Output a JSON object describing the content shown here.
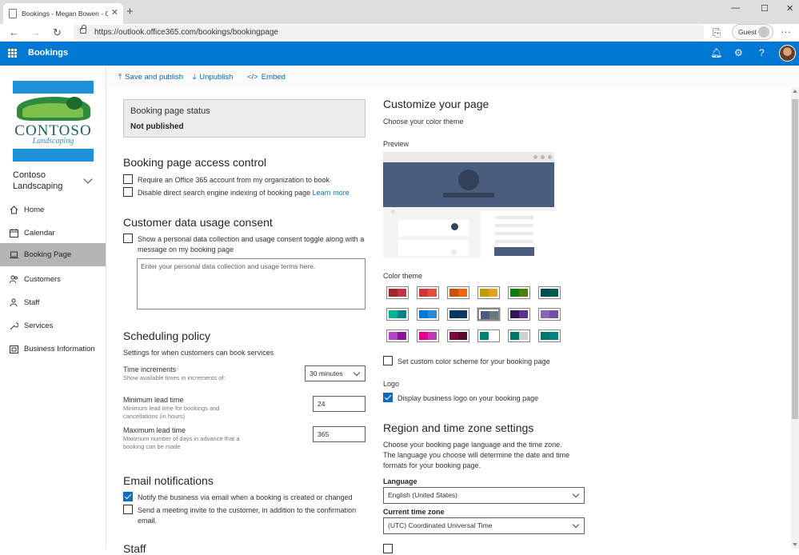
{
  "browser": {
    "tab_title": "Bookings - Megan Bowen - Outlook",
    "url": "https://outlook.office365.com/bookings/bookingpage",
    "guest_label": "Guest"
  },
  "app": {
    "name": "Bookings",
    "accent": "#0078d4"
  },
  "sidebar": {
    "logo_text": "CONTOSO",
    "logo_subtext": "Landscaping",
    "business_name": "Contoso Landscaping",
    "items": [
      {
        "label": "Home",
        "icon": "home-icon"
      },
      {
        "label": "Calendar",
        "icon": "calendar-icon"
      },
      {
        "label": "Booking Page",
        "icon": "laptop-icon",
        "active": true
      },
      {
        "label": "Customers",
        "icon": "customers-icon"
      },
      {
        "label": "Staff",
        "icon": "staff-icon"
      },
      {
        "label": "Services",
        "icon": "wrench-icon"
      },
      {
        "label": "Business Information",
        "icon": "building-icon"
      }
    ]
  },
  "toolbar": {
    "save": "Save and publish",
    "unpublish": "Unpublish",
    "embed": "Embed"
  },
  "status": {
    "label": "Booking page status",
    "value": "Not published"
  },
  "access": {
    "heading": "Booking page access control",
    "opt1": "Require an Office 365 account from my organization to book",
    "opt2": "Disable direct search engine indexing of booking page",
    "learn_more": "Learn more"
  },
  "consent": {
    "heading": "Customer data usage consent",
    "opt": "Show a personal data collection and usage consent toggle along with a message on my booking page",
    "placeholder": "Enter your personal data collection and usage terms here."
  },
  "scheduling": {
    "heading": "Scheduling policy",
    "subtitle": "Settings for when customers can book services",
    "increments_label": "Time increments",
    "increments_help": "Show available times in increments of:",
    "increments_value": "30 minutes",
    "min_label": "Minimum lead time",
    "min_help": "Minimum lead time for bookings and cancellations (in hours)",
    "min_value": "24",
    "max_label": "Maximum lead time",
    "max_help": "Maximum number of days in advance that a booking can be made",
    "max_value": "365"
  },
  "email": {
    "heading": "Email notifications",
    "opt1": "Notify the business via email when a booking is created or changed",
    "opt1_checked": true,
    "opt2": "Send a meeting invite to the customer, in addition to the confirmation email.",
    "opt2_checked": false,
    "next_heading": "Staff"
  },
  "customize": {
    "heading": "Customize your page",
    "subtitle": "Choose your color theme",
    "preview_label": "Preview",
    "color_theme_label": "Color theme",
    "swatches": [
      [
        "#a4262c",
        "#c4314b"
      ],
      [
        "#d13438",
        "#e74c3c"
      ],
      [
        "#ca5010",
        "#f7630c"
      ],
      [
        "#c19c00",
        "#e3a21a"
      ],
      [
        "#107c10",
        "#498205"
      ],
      [
        "#004b50",
        "#005e50"
      ],
      [
        "#00b294",
        "#038387"
      ],
      [
        "#0078d4",
        "#2b88d8"
      ],
      [
        "#003966",
        "#0b3c5d"
      ],
      [
        "#4a5d7e",
        "#69797e"
      ],
      [
        "#32145a",
        "#5c2e91"
      ],
      [
        "#8764b8",
        "#744da9"
      ],
      [
        "#b146c2",
        "#881798"
      ],
      [
        "#e3008c",
        "#c239b3"
      ],
      [
        "#7a0c3c",
        "#5e0a2d"
      ],
      [
        "#008272",
        "#ffffff"
      ],
      [
        "#00766b",
        "#d2d0ce"
      ],
      [
        "#00766b",
        "#038387"
      ]
    ],
    "selected_swatch": 9,
    "custom_scheme": "Set custom color scheme for your booking page",
    "logo_label": "Logo",
    "logo_opt": "Display business logo on your booking page",
    "logo_checked": true
  },
  "region": {
    "heading": "Region and time zone settings",
    "desc": "Choose your booking page language and the time zone. The language you choose will determine the date and time formats for your booking page.",
    "language_label": "Language",
    "language_value": "English (United States)",
    "timezone_label": "Current time zone",
    "timezone_value": "(UTC) Coordinated Universal Time"
  }
}
